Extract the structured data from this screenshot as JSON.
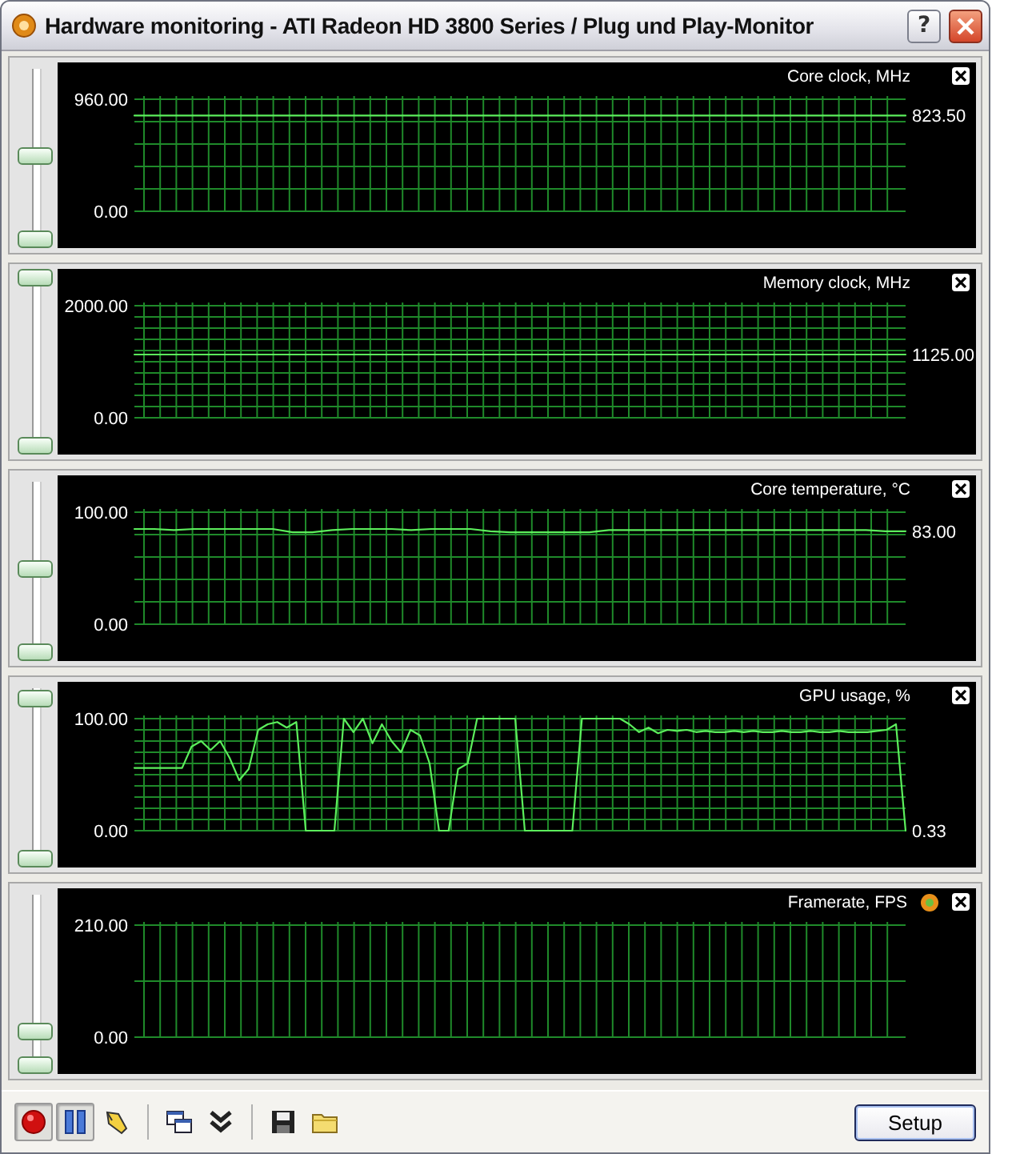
{
  "window": {
    "title": "Hardware monitoring - ATI Radeon HD 3800 Series / Plug und Play-Monitor",
    "help": "?"
  },
  "panels": [
    {
      "level": 0.5,
      "current": "823.50",
      "has_icon": false,
      "chart_data": {
        "type": "line",
        "title": "Core clock, MHz",
        "grid": true,
        "ylim": [
          0,
          960
        ],
        "yticks": [
          {
            "value": 0,
            "label": "0.00"
          },
          {
            "value": 960,
            "label": "960.00"
          }
        ],
        "series": [
          {
            "color": "#5cee5c",
            "values": [
              820,
              820,
              820,
              820,
              820,
              820,
              820,
              820,
              820,
              820
            ]
          }
        ]
      }
    },
    {
      "level": 1,
      "current": "1125.00",
      "has_icon": false,
      "chart_data": {
        "type": "line",
        "title": "Memory clock, MHz",
        "grid": true,
        "ylim": [
          0,
          2000
        ],
        "yticks": [
          {
            "value": 0,
            "label": "0.00"
          },
          {
            "value": 2000,
            "label": "2000.00"
          }
        ],
        "series": [
          {
            "color": "#5cee5c",
            "values": [
              1130,
              1130,
              1130,
              1130,
              1130,
              1130,
              1130,
              1130,
              1130,
              1130
            ]
          }
        ]
      }
    },
    {
      "level": 0.5,
      "current": "83.00",
      "has_icon": false,
      "chart_data": {
        "type": "line",
        "title": "Core temperature, °C",
        "grid": true,
        "ylim": [
          0,
          100
        ],
        "yticks": [
          {
            "value": 0,
            "label": "0.00"
          },
          {
            "value": 100,
            "label": "100.00"
          }
        ],
        "series": [
          {
            "color": "#5cee5c",
            "values": [
              85,
              85,
              84,
              85,
              85,
              85,
              85,
              85,
              82,
              82,
              84,
              85,
              85,
              85,
              84,
              85,
              85,
              85,
              83,
              82,
              82,
              82,
              82,
              82,
              84,
              84,
              84,
              84,
              84,
              84,
              84,
              84,
              84,
              84,
              84,
              84,
              84,
              84,
              83,
              83
            ]
          }
        ]
      }
    },
    {
      "level": 0.95,
      "current": "0.33",
      "has_icon": false,
      "chart_data": {
        "type": "line",
        "title": "GPU usage, %",
        "grid": true,
        "ylim": [
          0,
          100
        ],
        "yticks": [
          {
            "value": 0,
            "label": "0.00"
          },
          {
            "value": 100,
            "label": "100.00"
          }
        ],
        "series": [
          {
            "color": "#5cee5c",
            "values": [
              56,
              56,
              56,
              56,
              56,
              56,
              75,
              80,
              72,
              80,
              65,
              45,
              55,
              90,
              95,
              97,
              92,
              97,
              0,
              0,
              0,
              0,
              100,
              88,
              100,
              78,
              95,
              80,
              70,
              90,
              85,
              60,
              0,
              0,
              55,
              60,
              100,
              100,
              100,
              100,
              100,
              0,
              0,
              0,
              0,
              0,
              0,
              100,
              100,
              100,
              100,
              100,
              95,
              88,
              92,
              87,
              90,
              89,
              90,
              88,
              89,
              88,
              88,
              89,
              88,
              89,
              88,
              88,
              89,
              88,
              88,
              89,
              88,
              88,
              89,
              88,
              88,
              88,
              89,
              90,
              95,
              0
            ]
          }
        ]
      }
    },
    {
      "level": 0.2,
      "has_icon": true,
      "axis_labels": [
        "210.00",
        "0.00"
      ],
      "chart_data": {
        "type": "other",
        "title": "Framerate, FPS"
      }
    }
  ],
  "toolbar": {
    "items": [
      {
        "kind": "record",
        "pressed": true
      },
      {
        "kind": "pause",
        "pressed": true
      },
      {
        "kind": "pen",
        "pressed": false
      },
      {
        "kind": "separator"
      },
      {
        "kind": "windows",
        "pressed": false
      },
      {
        "kind": "chevrons",
        "pressed": false
      },
      {
        "kind": "separator"
      },
      {
        "kind": "save",
        "pressed": false
      },
      {
        "kind": "folder",
        "pressed": false
      }
    ],
    "setup_button": "Setup"
  }
}
